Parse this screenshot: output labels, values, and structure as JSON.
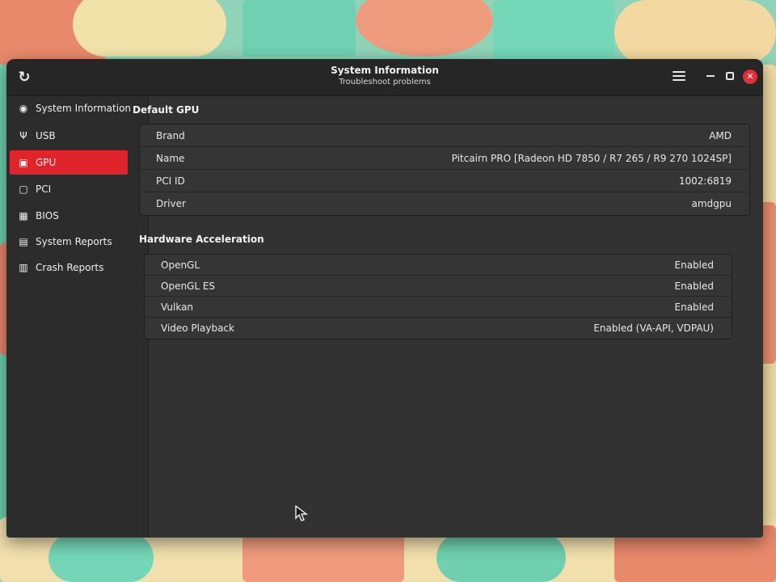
{
  "window": {
    "title": "System Information",
    "subtitle": "Troubleshoot problems"
  },
  "sidebar": {
    "items": [
      {
        "label": "System Information",
        "icon": "location-pin-icon",
        "active": false
      },
      {
        "label": "USB",
        "icon": "usb-icon",
        "active": false
      },
      {
        "label": "GPU",
        "icon": "monitor-icon",
        "active": true
      },
      {
        "label": "PCI",
        "icon": "pci-card-icon",
        "active": false
      },
      {
        "label": "BIOS",
        "icon": "chip-icon",
        "active": false
      },
      {
        "label": "System Reports",
        "icon": "report-icon",
        "active": false
      },
      {
        "label": "Crash Reports",
        "icon": "crash-report-icon",
        "active": false
      }
    ]
  },
  "default_gpu": {
    "title": "Default GPU",
    "rows": [
      {
        "key": "Brand",
        "value": "AMD"
      },
      {
        "key": "Name",
        "value": "Pitcairn PRO [Radeon HD 7850 / R7 265 / R9 270 1024SP]"
      },
      {
        "key": "PCI ID",
        "value": "1002:6819"
      },
      {
        "key": "Driver",
        "value": "amdgpu"
      }
    ]
  },
  "hardware_acceleration": {
    "title": "Hardware Acceleration",
    "rows": [
      {
        "key": "OpenGL",
        "value": "Enabled"
      },
      {
        "key": "OpenGL ES",
        "value": "Enabled"
      },
      {
        "key": "Vulkan",
        "value": "Enabled"
      },
      {
        "key": "Video Playback",
        "value": "Enabled (VA-API, VDPAU)"
      }
    ]
  },
  "colors": {
    "accent": "#e0242c",
    "window_bg": "#323232",
    "headerbar_bg": "#262626"
  }
}
